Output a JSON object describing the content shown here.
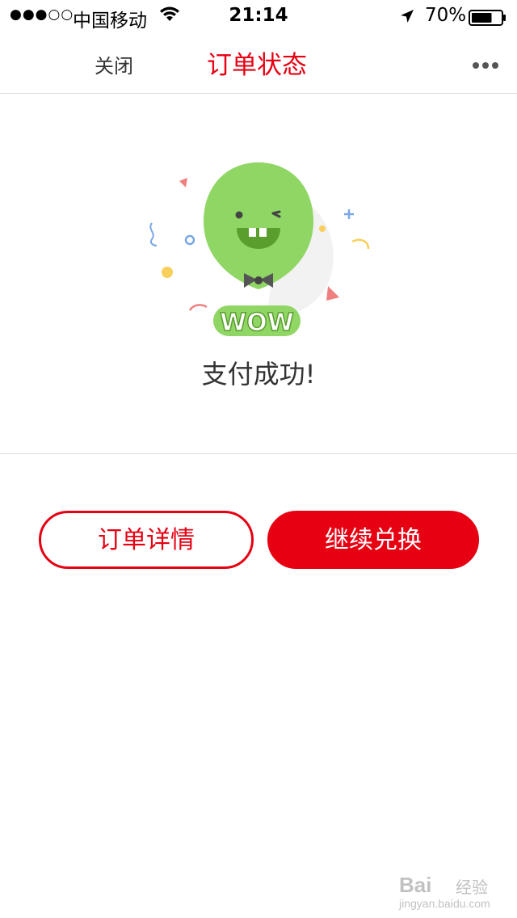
{
  "status_bar": {
    "signal": "●●●○○",
    "carrier": "中国移动",
    "time": "21:14",
    "battery_percent": "70%",
    "battery_level": 0.7,
    "icons": [
      "wifi-icon",
      "location-arrow-icon",
      "battery-icon"
    ]
  },
  "nav": {
    "close_label": "关闭",
    "title": "订单状态",
    "more_icon": "more-dots-icon"
  },
  "success": {
    "illustration_text": "WOW",
    "message": "支付成功!"
  },
  "actions": {
    "order_details_label": "订单详情",
    "continue_exchange_label": "继续兑换"
  },
  "watermark": {
    "brand": "Bai",
    "suffix": "经验",
    "url": "jingyan.baidu.com"
  },
  "colors": {
    "accent": "#e60012",
    "balloon": "#8fd665",
    "text_primary": "#333333"
  }
}
